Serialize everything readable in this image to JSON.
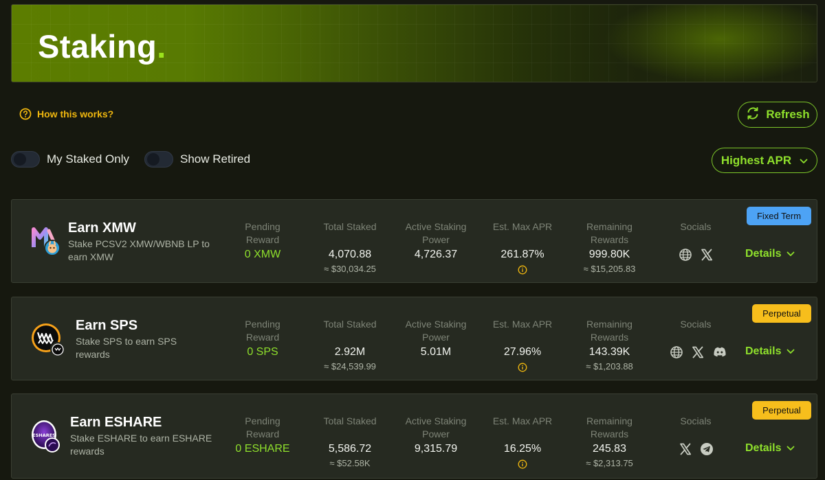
{
  "banner": {
    "title": "Staking",
    "dot": "."
  },
  "help": {
    "label": "How this works?"
  },
  "refresh": {
    "label": "Refresh"
  },
  "filters": {
    "my_staked_only": {
      "label": "My Staked Only",
      "on": false
    },
    "show_retired": {
      "label": "Show Retired",
      "on": false
    }
  },
  "sort": {
    "selected": "Highest APR"
  },
  "column_labels": {
    "pending": "Pending Reward",
    "total_staked": "Total Staked",
    "power": "Active Staking Power",
    "apr": "Est. Max APR",
    "remaining": "Remaining Rewards",
    "socials": "Socials",
    "details": "Details"
  },
  "pools": [
    {
      "name": "Earn XMW",
      "description": "Stake PCSV2 XMW/WBNB LP to earn XMW",
      "pending": "0 XMW",
      "total_staked": "4,070.88",
      "total_staked_usd": "≈ $30,034.25",
      "power": "4,726.37",
      "apr": "261.87%",
      "remaining": "999.80K",
      "remaining_usd": "≈ $15,205.83",
      "badge": "Fixed Term",
      "socials": [
        "globe-icon",
        "x-icon"
      ]
    },
    {
      "name": "Earn SPS",
      "description": "Stake SPS to earn SPS rewards",
      "pending": "0 SPS",
      "total_staked": "2.92M",
      "total_staked_usd": "≈ $24,539.99",
      "power": "5.01M",
      "apr": "27.96%",
      "remaining": "143.39K",
      "remaining_usd": "≈ $1,203.88",
      "badge": "Perpetual",
      "socials": [
        "globe-icon",
        "x-icon",
        "discord-icon"
      ]
    },
    {
      "name": "Earn ESHARE",
      "description": "Stake ESHARE to earn ESHARE rewards",
      "pending": "0 ESHARE",
      "total_staked": "5,586.72",
      "total_staked_usd": "≈ $52.58K",
      "power": "9,315.79",
      "apr": "16.25%",
      "remaining": "245.83",
      "remaining_usd": "≈ $2,313.75",
      "badge": "Perpetual",
      "socials": [
        "x-icon",
        "telegram-icon"
      ],
      "logo_text": "ESHARES"
    }
  ],
  "colors": {
    "accent_green": "#8fe02c",
    "help_yellow": "#f1b80f",
    "badge_blue": "#4da3f5",
    "badge_yellow": "#f7be1c",
    "background": "#16180f",
    "card": "#262a21"
  }
}
